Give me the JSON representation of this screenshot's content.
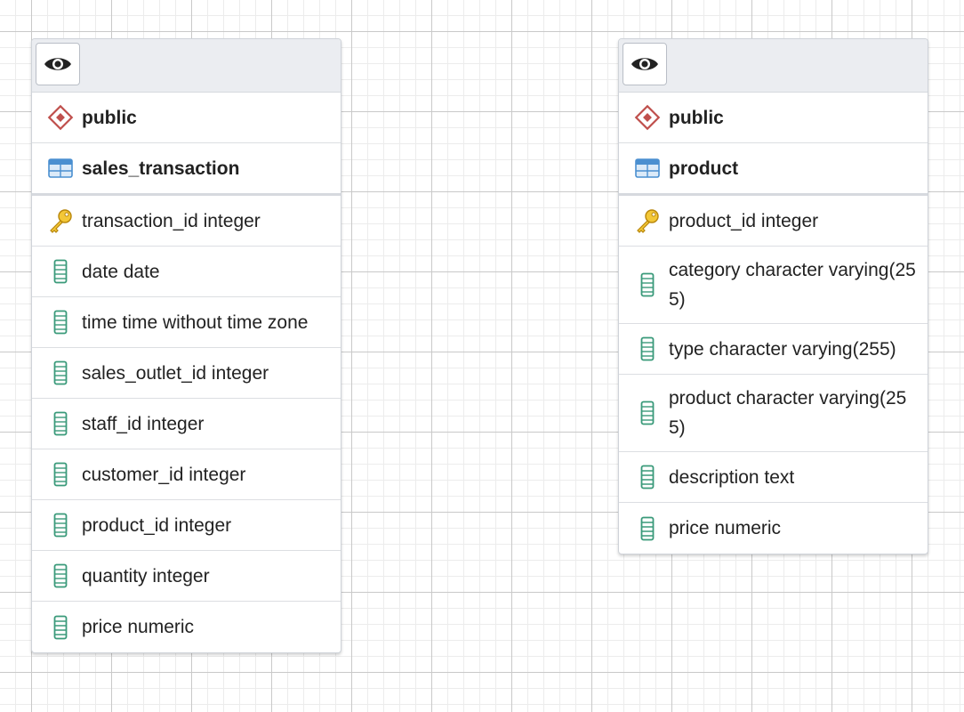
{
  "tables": [
    {
      "schema": "public",
      "name": "sales_transaction",
      "columns": [
        {
          "text": "transaction_id integer",
          "icon": "primary-key-icon"
        },
        {
          "text": "date date",
          "icon": "column-icon"
        },
        {
          "text": "time time without time zone",
          "icon": "column-icon"
        },
        {
          "text": "sales_outlet_id integer",
          "icon": "column-icon"
        },
        {
          "text": "staff_id integer",
          "icon": "column-icon"
        },
        {
          "text": "customer_id integer",
          "icon": "column-icon"
        },
        {
          "text": "product_id integer",
          "icon": "column-icon"
        },
        {
          "text": "quantity integer",
          "icon": "column-icon"
        },
        {
          "text": "price numeric",
          "icon": "column-icon"
        }
      ]
    },
    {
      "schema": "public",
      "name": "product",
      "columns": [
        {
          "text": "product_id integer",
          "icon": "primary-key-icon"
        },
        {
          "text": "category character varying(255)",
          "icon": "column-icon"
        },
        {
          "text": "type character varying(255)",
          "icon": "column-icon"
        },
        {
          "text": "product character varying(255)",
          "icon": "column-icon"
        },
        {
          "text": "description text",
          "icon": "column-icon"
        },
        {
          "text": "price numeric",
          "icon": "column-icon"
        }
      ]
    }
  ],
  "colors": {
    "schema_icon": "#c0504d",
    "table_icon": "#4a8fd0",
    "key_icon": "#e6b422",
    "column_icon": "#3a9a7a"
  }
}
